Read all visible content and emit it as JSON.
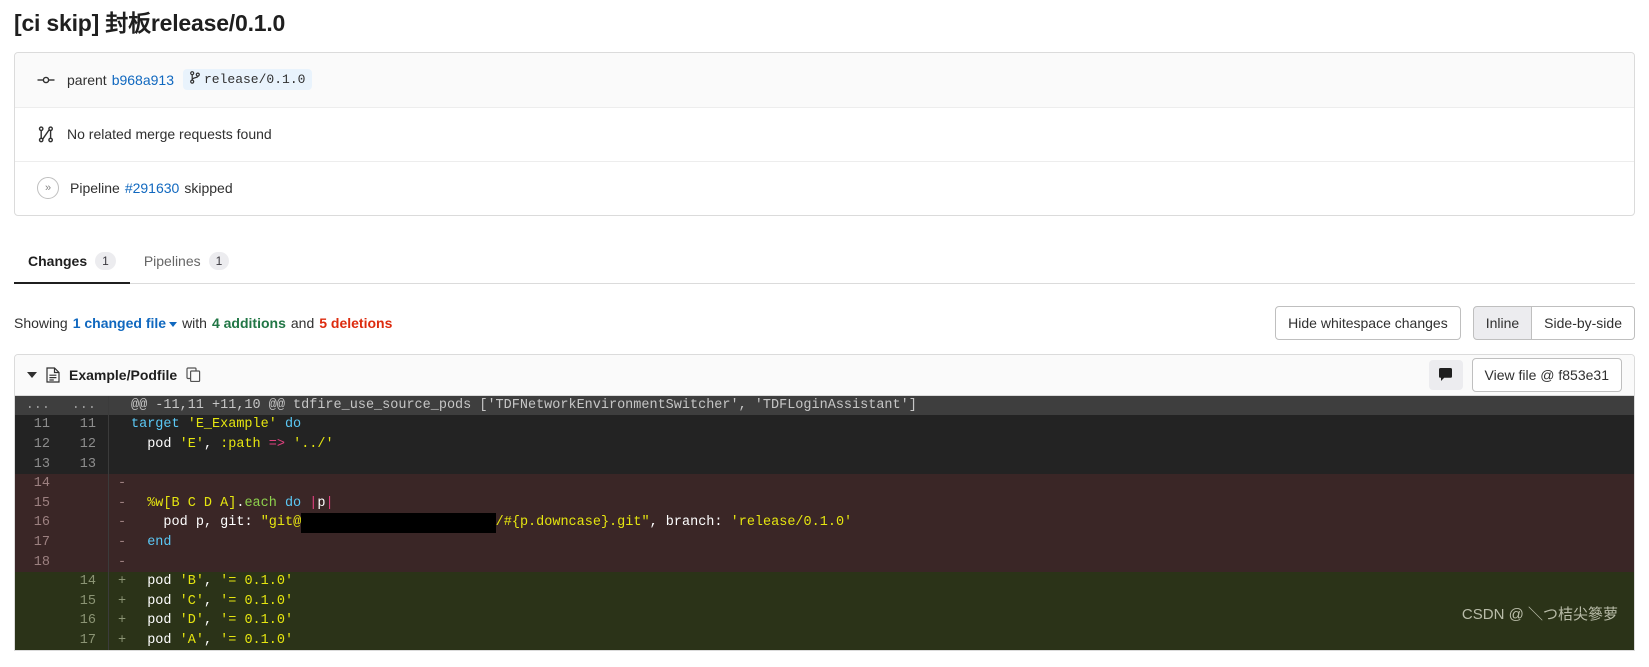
{
  "commit": {
    "title": "[ci skip] 封板release/0.1.0"
  },
  "info": {
    "parent_label": "parent",
    "parent_sha": "b968a913",
    "branch": "release/0.1.0",
    "branch_icon": "branch-icon",
    "commit_icon": "commit-dot-icon",
    "merge_requests_text": "No related merge requests found",
    "merge_request_icon": "merge-request-icon",
    "pipeline_label": "Pipeline",
    "pipeline_id": "#291630",
    "pipeline_status": "skipped",
    "pipeline_icon": "skipped-icon"
  },
  "tabs": [
    {
      "label": "Changes",
      "count": "1",
      "active": true
    },
    {
      "label": "Pipelines",
      "count": "1",
      "active": false
    }
  ],
  "showing": {
    "prefix": "Showing",
    "changed_files": "1 changed file",
    "with": "with",
    "additions": "4 additions",
    "and": "and",
    "deletions": "5 deletions"
  },
  "view_controls": {
    "whitespace": "Hide whitespace changes",
    "inline": "Inline",
    "side_by_side": "Side-by-side",
    "selected": "Inline"
  },
  "diff": {
    "file_name": "Example/Podfile",
    "file_icon": "document-icon",
    "copy_icon": "copy-path-icon",
    "collapse_icon": "chevron-down-icon",
    "comment_icon": "comment-icon",
    "view_file_label": "View file @ f853e31",
    "hunk": "@@ -11,11 +11,10 @@ tdfire_use_source_pods ['TDFNetworkEnvironmentSwitcher', 'TDFLoginAssistant']",
    "lines": [
      {
        "type": "hunk",
        "old": "...",
        "new": "...",
        "sign": ""
      },
      {
        "type": "context",
        "old": "11",
        "new": "11",
        "sign": "",
        "text": "target 'E_Example' do"
      },
      {
        "type": "context",
        "old": "12",
        "new": "12",
        "sign": "",
        "text": "  pod 'E', :path => '../'"
      },
      {
        "type": "context",
        "old": "13",
        "new": "13",
        "sign": "",
        "text": ""
      },
      {
        "type": "del",
        "old": "14",
        "new": "",
        "sign": "-",
        "text": ""
      },
      {
        "type": "del",
        "old": "15",
        "new": "",
        "sign": "-",
        "text": "  %w[B C D A].each do |p|"
      },
      {
        "type": "del",
        "old": "16",
        "new": "",
        "sign": "-",
        "text": "    pod p, git: \"git@[redacted]/#{p.downcase}.git\", branch: 'release/0.1.0'"
      },
      {
        "type": "del",
        "old": "17",
        "new": "",
        "sign": "-",
        "text": "  end"
      },
      {
        "type": "del",
        "old": "18",
        "new": "",
        "sign": "-",
        "text": ""
      },
      {
        "type": "add",
        "old": "",
        "new": "14",
        "sign": "+",
        "text": "  pod 'B', '= 0.1.0'"
      },
      {
        "type": "add",
        "old": "",
        "new": "15",
        "sign": "+",
        "text": "  pod 'C', '= 0.1.0'"
      },
      {
        "type": "add",
        "old": "",
        "new": "16",
        "sign": "+",
        "text": "  pod 'D', '= 0.1.0'"
      },
      {
        "type": "add",
        "old": "",
        "new": "17",
        "sign": "+",
        "text": "  pod 'A', '= 0.1.0'"
      }
    ]
  },
  "watermark": "CSDN @ ＼つ桔尖篸萝"
}
